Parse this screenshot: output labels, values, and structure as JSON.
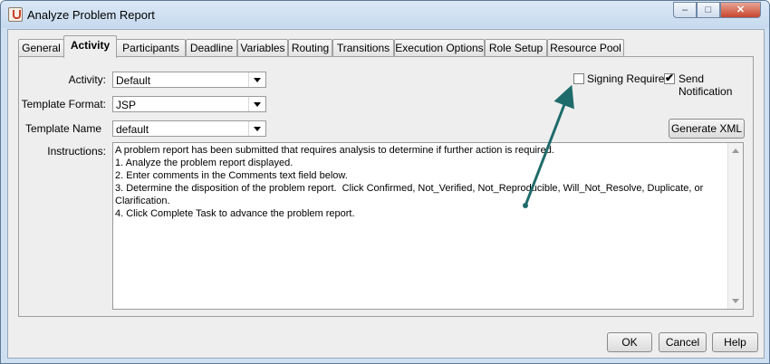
{
  "window": {
    "title": "Analyze Problem Report",
    "minimize_glyph": "–",
    "maximize_glyph": "□",
    "close_glyph": "✕"
  },
  "tabs": [
    {
      "label": "General"
    },
    {
      "label": "Activity",
      "active": true
    },
    {
      "label": "Participants"
    },
    {
      "label": "Deadline"
    },
    {
      "label": "Variables"
    },
    {
      "label": "Routing"
    },
    {
      "label": "Transitions"
    },
    {
      "label": "Execution Options"
    },
    {
      "label": "Role Setup"
    },
    {
      "label": "Resource Pool"
    }
  ],
  "form": {
    "activity_label": "Activity:",
    "activity_value": "Default",
    "template_format_label": "Template Format:",
    "template_format_value": "JSP",
    "template_name_label": "Template Name",
    "template_name_value": "default",
    "instructions_label": "Instructions:",
    "signing_required_label": "Signing Required",
    "signing_required_checked": false,
    "send_notification_label": "Send Notification",
    "send_notification_checked": true,
    "checkmark_glyph": "✔",
    "generate_xml_label": "Generate XML",
    "instructions_lines": [
      "A problem report has been submitted that requires analysis to determine if further action is required.",
      "1. Analyze the problem report displayed.",
      "2. Enter comments in the Comments text field below.",
      "3. Determine the disposition of the problem report.  Click Confirmed, Not_Verified, Not_Reproducible, Will_Not_Resolve, Duplicate, or Clarification.",
      "4. Click Complete Task to advance the problem report."
    ]
  },
  "buttons": {
    "ok": "OK",
    "cancel": "Cancel",
    "help": "Help"
  },
  "colors": {
    "annotation_arrow": "#1f6b6b"
  }
}
